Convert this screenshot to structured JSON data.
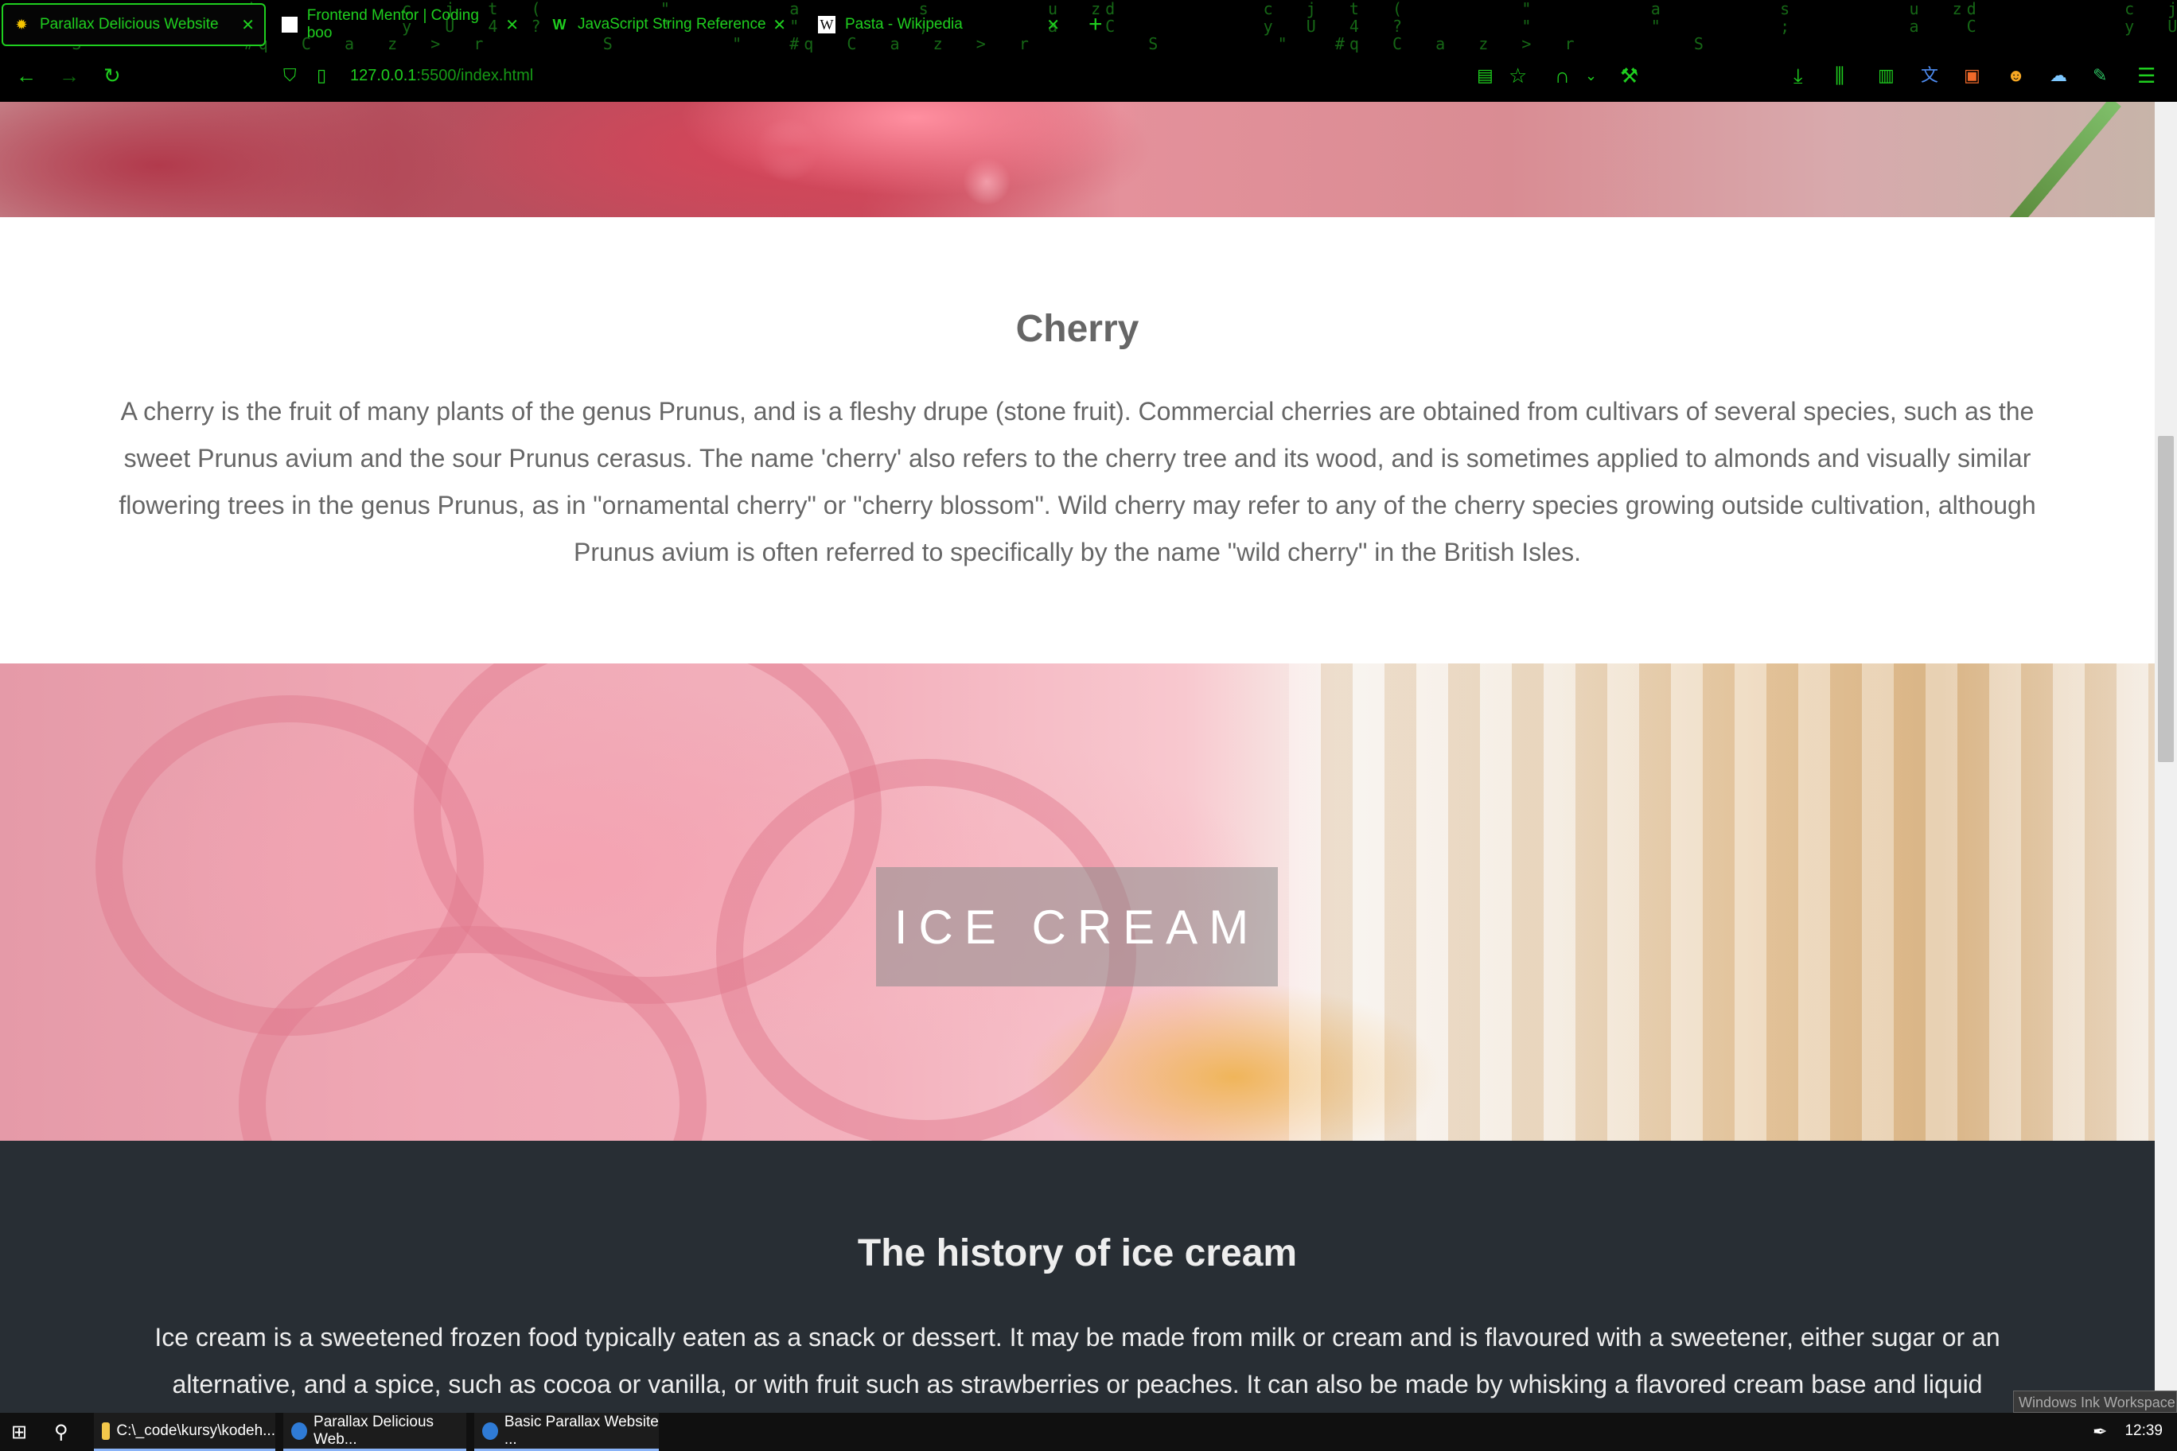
{
  "browser": {
    "tabs": [
      {
        "title": "Parallax Delicious Website",
        "active": true
      },
      {
        "title": "Frontend Mentor | Coding boo",
        "active": false
      },
      {
        "title": "JavaScript String Reference",
        "active": false
      },
      {
        "title": "Pasta - Wikipedia",
        "active": false
      }
    ],
    "new_tab": "+",
    "url_host": "127.0.0.1",
    "url_rest": ":5500/index.html",
    "accent_color": "#1fcf1f"
  },
  "page": {
    "cherry": {
      "heading": "Cherry",
      "text": "A cherry is the fruit of many plants of the genus Prunus, and is a fleshy drupe (stone fruit). Commercial cherries are obtained from cultivars of several species, such as the sweet Prunus avium and the sour Prunus cerasus. The name 'cherry' also refers to the cherry tree and its wood, and is sometimes applied to almonds and visually similar flowering trees in the genus Prunus, as in \"ornamental cherry\" or \"cherry blossom\". Wild cherry may refer to any of the cherry species growing outside cultivation, although Prunus avium is often referred to specifically by the name \"wild cherry\" in the British Isles."
    },
    "banner_label": "ICE CREAM",
    "history": {
      "heading": "The history of ice cream",
      "text": "Ice cream is a sweetened frozen food typically eaten as a snack or dessert. It may be made from milk or cream and is flavoured with a sweetener, either sugar or an alternative, and a spice, such as cocoa or vanilla, or with fruit such as strawberries or peaches. It can also be made by whisking a flavored cream base and liquid"
    },
    "ink_popup": "Windows Ink Workspace"
  },
  "taskbar": {
    "items": [
      {
        "label": "C:\\_code\\kursy\\kodeh..."
      },
      {
        "label": "Parallax Delicious Web..."
      },
      {
        "label": "Basic Parallax Website ..."
      }
    ],
    "clock": "12:39"
  }
}
